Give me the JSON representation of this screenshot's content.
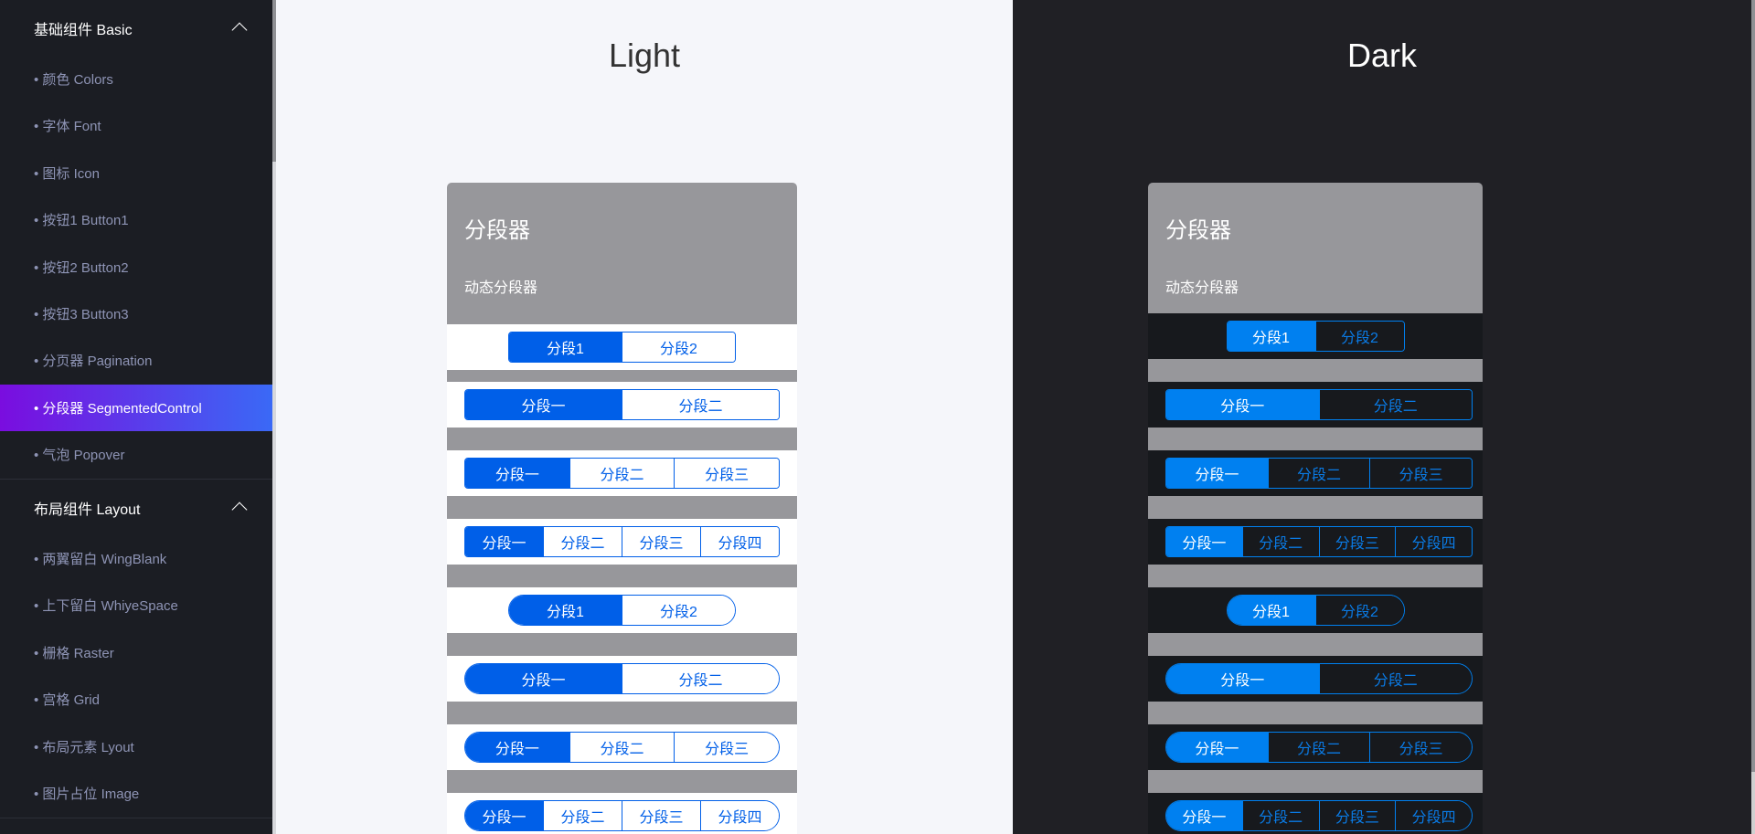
{
  "sidebar": {
    "groups": [
      {
        "label": "基础组件 Basic",
        "items": [
          "• 颜色 Colors",
          "• 字体 Font",
          "• 图标 Icon",
          "• 按钮1 Button1",
          "• 按钮2 Button2",
          "• 按钮3 Button3",
          "• 分页器 Pagination",
          "• 分段器 SegmentedControl",
          "• 气泡 Popover"
        ]
      },
      {
        "label": "布局组件 Layout",
        "items": [
          "• 两翼留白 WingBlank",
          "• 上下留白 WhiyeSpace",
          "• 栅格 Raster",
          "• 宫格 Grid",
          "• 布局元素 Lyout",
          "• 图片占位 Image"
        ]
      }
    ],
    "active_item": "• 分段器 SegmentedControl"
  },
  "panes": [
    {
      "title": "Light",
      "theme": "light",
      "row_bg": "#ffffff",
      "active_color": "#005fe8",
      "text_color": "#005fe8",
      "seg_bg": "#ffffff"
    },
    {
      "title": "Dark",
      "theme": "dark",
      "row_bg": "#17191d",
      "active_color": "#0080f0",
      "text_color": "#0a7be6",
      "seg_bg": "#17191d"
    }
  ],
  "card": {
    "title": "分段器",
    "subtitle": "动态分段器"
  },
  "controls": [
    {
      "segments": [
        "分段1",
        "分段2"
      ],
      "selected": 0,
      "shape": "rounded",
      "compact": true
    },
    {
      "segments": [
        "分段一",
        "分段二"
      ],
      "selected": 0,
      "shape": "rounded",
      "compact": false
    },
    {
      "segments": [
        "分段一",
        "分段二",
        "分段三"
      ],
      "selected": 0,
      "shape": "rounded",
      "compact": false
    },
    {
      "segments": [
        "分段一",
        "分段二",
        "分段三",
        "分段四"
      ],
      "selected": 0,
      "shape": "rounded",
      "compact": false
    },
    {
      "segments": [
        "分段1",
        "分段2"
      ],
      "selected": 0,
      "shape": "pill",
      "compact": true
    },
    {
      "segments": [
        "分段一",
        "分段二"
      ],
      "selected": 0,
      "shape": "pill",
      "compact": false
    },
    {
      "segments": [
        "分段一",
        "分段二",
        "分段三"
      ],
      "selected": 0,
      "shape": "pill",
      "compact": false
    },
    {
      "segments": [
        "分段一",
        "分段二",
        "分段三",
        "分段四"
      ],
      "selected": 0,
      "shape": "pill",
      "compact": false
    }
  ]
}
